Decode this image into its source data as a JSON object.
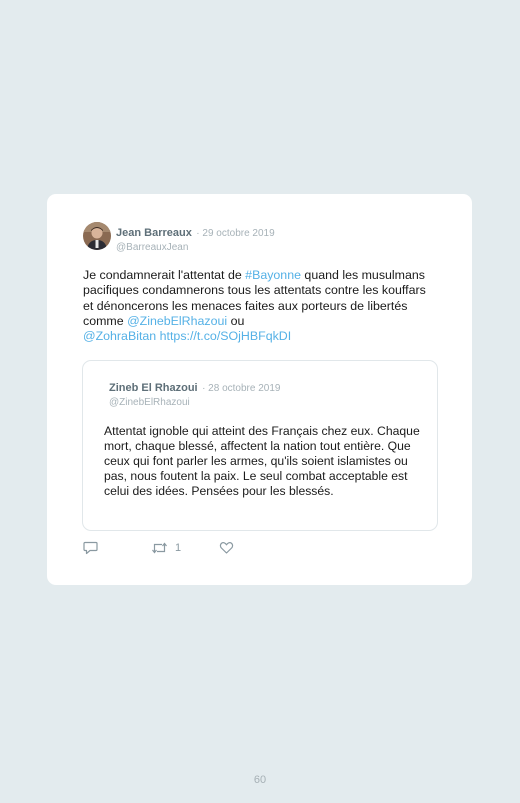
{
  "tweet": {
    "author_name": "Jean Barreaux",
    "date": "· 29 octobre 2019",
    "handle": "@BarreauxJean",
    "text_1": "Je condamnerait l'attentat de ",
    "hashtag": "#Bayonne",
    "text_2": " quand les musulmans pacifiques condamnerons tous les attentats contre les kouffars et dénoncerons les menaces faites aux porteurs de libertés comme ",
    "mention_1": "@ZinebElRhazoui",
    "text_3": " ou",
    "mention_2": "@ZohraBitan",
    "url": "https://t.co/SOjHBFqkDI",
    "retweet_count": "1"
  },
  "quoted_tweet": {
    "author_name": "Zineb El Rhazoui",
    "date": "· 28 octobre 2019",
    "handle": "@ZinebElRhazoui",
    "text": "Attentat ignoble qui atteint des Français chez eux. Chaque mort, chaque blessé, affectent la nation tout entière. Que ceux qui font parler les armes, qu'ils soient islamistes ou pas, nous foutent la paix. Le seul combat acceptable est celui des idées. Pensées pour les blessés."
  },
  "page": {
    "number": "60"
  },
  "icons": {
    "reply": "reply-icon",
    "retweet": "retweet-icon",
    "like": "heart-icon"
  },
  "colors": {
    "background": "#e3ebee",
    "link": "#55b1e6",
    "card": "#ffffff"
  }
}
